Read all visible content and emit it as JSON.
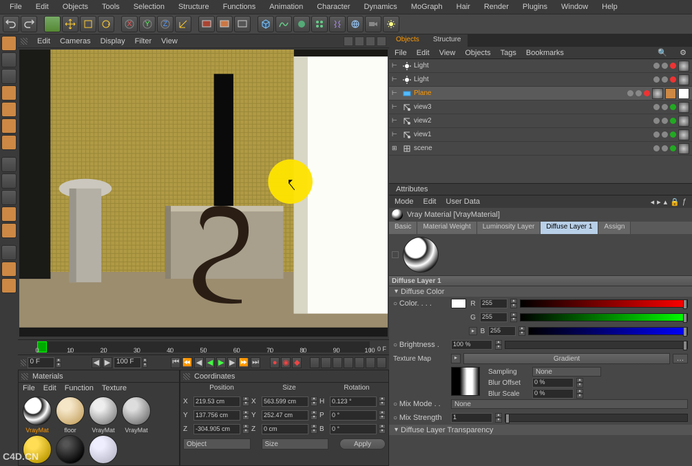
{
  "menu": [
    "File",
    "Edit",
    "Objects",
    "Tools",
    "Selection",
    "Structure",
    "Functions",
    "Animation",
    "Character",
    "Dynamics",
    "MoGraph",
    "Hair",
    "Render",
    "Plugins",
    "Window",
    "Help"
  ],
  "viewport_menu": [
    "Edit",
    "Cameras",
    "Display",
    "Filter",
    "View"
  ],
  "timeline": {
    "ticks": [
      0,
      10,
      20,
      30,
      40,
      50,
      60,
      70,
      80,
      90,
      100
    ],
    "start": "0 F",
    "end": "100 F",
    "current": "0 F"
  },
  "right_tabs": {
    "objects": "Objects",
    "structure": "Structure"
  },
  "object_menu": [
    "File",
    "Edit",
    "View",
    "Objects",
    "Tags",
    "Bookmarks"
  ],
  "objects": [
    {
      "name": "Light",
      "icon": "light",
      "sel": false
    },
    {
      "name": "Light",
      "icon": "light",
      "sel": false
    },
    {
      "name": "Plane",
      "icon": "plane",
      "sel": true
    },
    {
      "name": "view3",
      "icon": "view",
      "sel": false
    },
    {
      "name": "view2",
      "icon": "view",
      "sel": false
    },
    {
      "name": "view1",
      "icon": "view",
      "sel": false
    },
    {
      "name": "scene",
      "icon": "null",
      "sel": false
    }
  ],
  "attributes": {
    "title": "Attributes",
    "menu": [
      "Mode",
      "Edit",
      "User Data"
    ],
    "material_name": "Vray Material [VrayMaterial]",
    "tabs": [
      "Basic",
      "Material Weight",
      "Luminosity Layer",
      "Diffuse Layer 1",
      "Assign"
    ],
    "active_tab": "Diffuse Layer 1",
    "section": "Diffuse Layer 1",
    "diffuse_color_head": "Diffuse Color",
    "color_label": "Color. . . .",
    "rgb": {
      "r": 255,
      "g": 255,
      "b": 255
    },
    "brightness_label": "Brightness .",
    "brightness": "100 %",
    "texmap_label": "Texture Map",
    "texmap_btn": "Gradient",
    "sampling_label": "Sampling",
    "sampling_value": "None",
    "blur_offset_label": "Blur Offset",
    "blur_offset": "0 %",
    "blur_scale_label": "Blur Scale",
    "blur_scale": "0 %",
    "mixmode_label": "Mix Mode . .",
    "mixmode_value": "None",
    "mixstrength_label": "Mix Strength",
    "mixstrength": "1",
    "transparency_head": "Diffuse Layer Transparency"
  },
  "materials": {
    "title": "Materials",
    "menu": [
      "File",
      "Edit",
      "Function",
      "Texture"
    ],
    "items": [
      {
        "name": "VrayMat",
        "style": "radial-gradient(circle at 35% 30%, #fff 30%, #222 35%, #fff 55%, #000 80%)",
        "sel": true
      },
      {
        "name": "floor",
        "style": "radial-gradient(circle at 35% 30%, #f5e6c8 20%, #c9a86a 80%)"
      },
      {
        "name": "VrayMat",
        "style": "radial-gradient(circle at 35% 30%, #eee 20%, #888 80%)"
      },
      {
        "name": "VrayMat",
        "style": "radial-gradient(circle at 35% 30%, #ddd 20%, #777 80%)"
      },
      {
        "name": "",
        "style": "radial-gradient(circle at 35% 30%, #fd5 20%, #b90 80%)"
      },
      {
        "name": "",
        "style": "radial-gradient(circle at 35% 30%, #555 10%, #000 80%)"
      },
      {
        "name": "",
        "style": "radial-gradient(circle at 35% 30%, #eef 20%, #bbc 80%)"
      }
    ]
  },
  "coordinates": {
    "title": "Coordinates",
    "headers": [
      "Position",
      "Size",
      "Rotation"
    ],
    "rows": [
      {
        "axis": "X",
        "p": "219.53 cm",
        "s": "563.599 cm",
        "rl": "H",
        "r": "0.123 °"
      },
      {
        "axis": "Y",
        "p": "137.756 cm",
        "s": "252.47 cm",
        "rl": "P",
        "r": "0 °"
      },
      {
        "axis": "Z",
        "p": "-304.905 cm",
        "s": "0 cm",
        "rl": "B",
        "r": "0 °"
      }
    ],
    "object_drop": "Object",
    "size_drop": "Size",
    "apply": "Apply"
  },
  "watermark": "C4D.CN"
}
